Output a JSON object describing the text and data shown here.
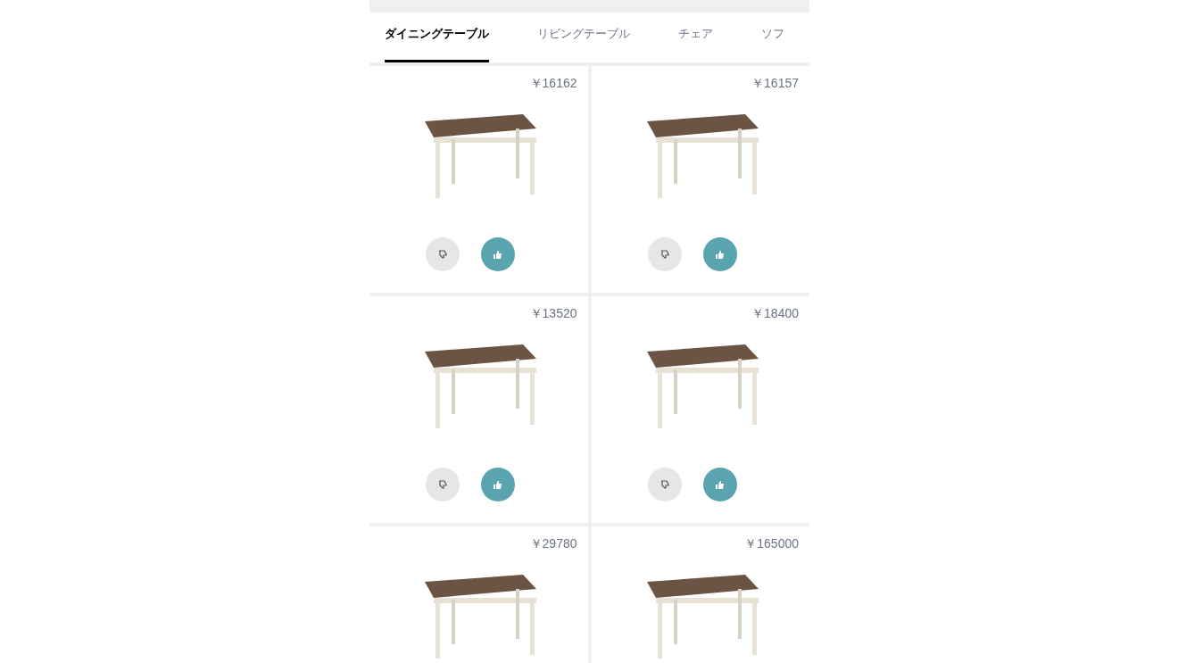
{
  "tabs": [
    {
      "label": "ダイニングテーブル",
      "selected": true
    },
    {
      "label": "リビングテーブル",
      "selected": false
    },
    {
      "label": "チェア",
      "selected": false
    },
    {
      "label": "ソフ",
      "selected": false
    }
  ],
  "products": [
    {
      "price": "￥16162"
    },
    {
      "price": "￥16157"
    },
    {
      "price": "￥13520"
    },
    {
      "price": "￥18400"
    },
    {
      "price": "￥29780"
    },
    {
      "price": "￥165000"
    }
  ]
}
